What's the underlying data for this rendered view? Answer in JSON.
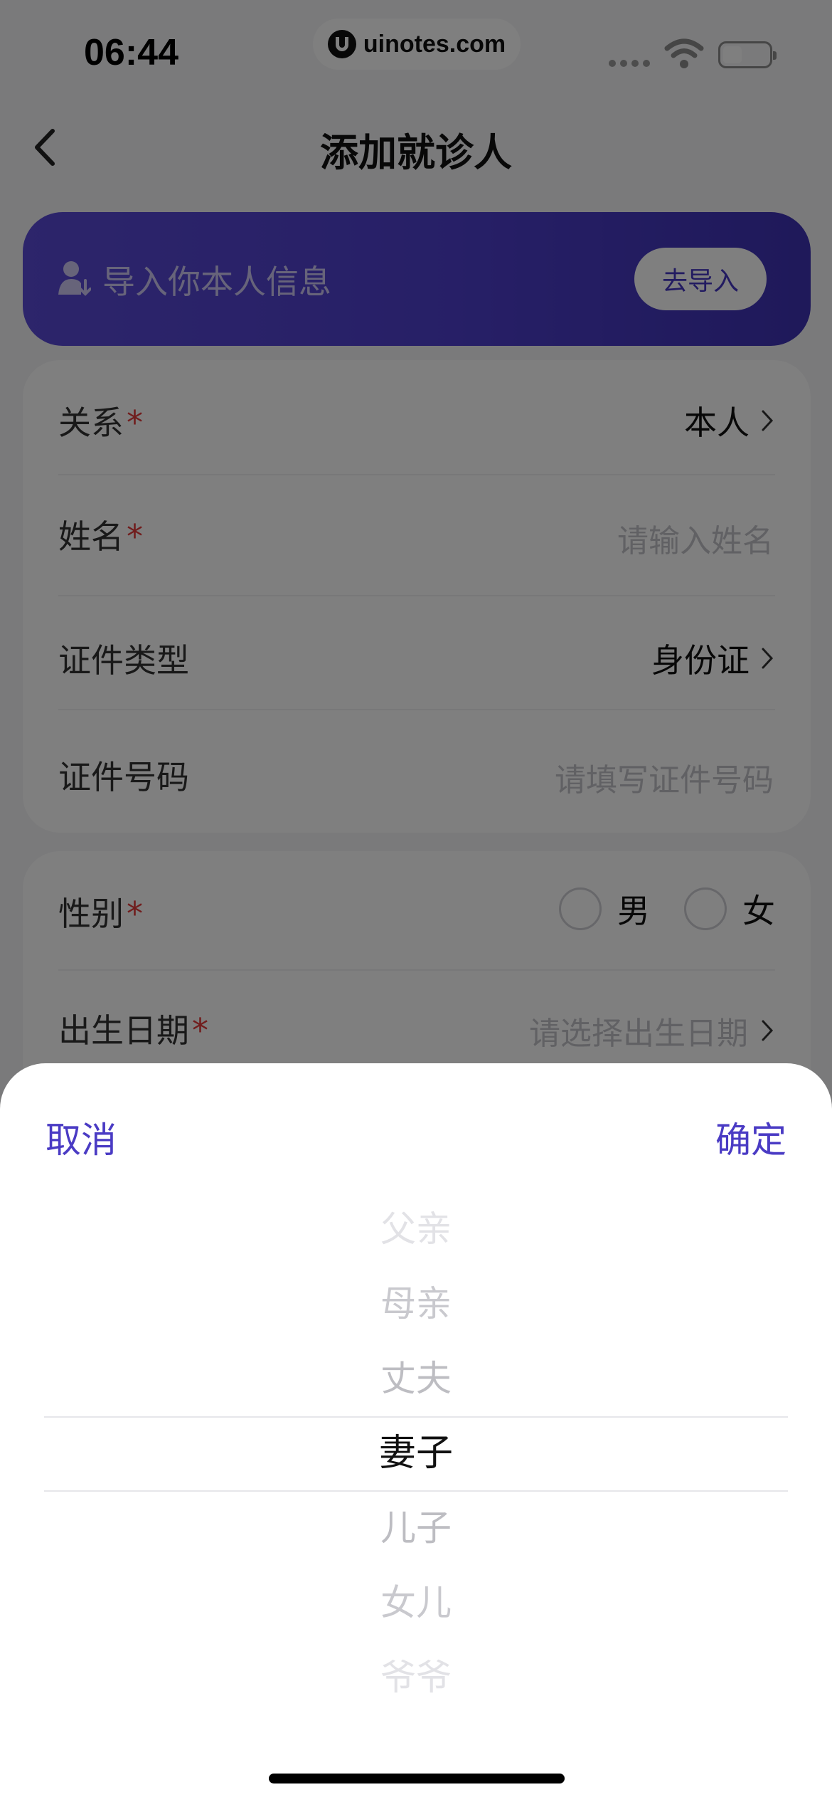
{
  "status_bar": {
    "time": "06:44",
    "url": "uinotes.com"
  },
  "nav": {
    "title": "添加就诊人"
  },
  "import_banner": {
    "text": "导入你本人信息",
    "button_label": "去导入"
  },
  "form": {
    "relation": {
      "label": "关系",
      "required_mark": "*",
      "value": "本人"
    },
    "name": {
      "label": "姓名",
      "required_mark": "*",
      "placeholder": "请输入姓名"
    },
    "id_type": {
      "label": "证件类型",
      "value": "身份证"
    },
    "id_number": {
      "label": "证件号码",
      "placeholder": "请填写证件号码"
    },
    "gender": {
      "label": "性别",
      "required_mark": "*",
      "options": [
        "男",
        "女"
      ]
    },
    "birthday": {
      "label": "出生日期",
      "required_mark": "*",
      "placeholder": "请选择出生日期"
    }
  },
  "sheet": {
    "cancel_label": "取消",
    "confirm_label": "确定",
    "options": [
      "父亲",
      "母亲",
      "丈夫",
      "妻子",
      "儿子",
      "女儿",
      "爷爷"
    ],
    "selected": "妻子"
  },
  "colors": {
    "accent": "#4a3bc4",
    "banner": "#4e3fce",
    "required": "#e23b3b"
  },
  "icons": [
    "back-chevron-icon",
    "user-import-icon",
    "chevron-right-icon",
    "wifi-icon",
    "battery-icon",
    "site-logo-icon"
  ]
}
